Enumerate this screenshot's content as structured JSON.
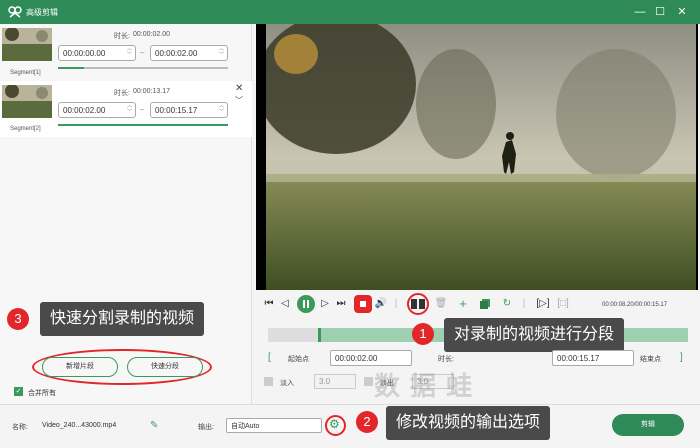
{
  "window": {
    "title": "高级剪辑"
  },
  "segments": [
    {
      "label": "Segment[1]",
      "duration_label": "时长:",
      "duration": "00:00:02.00",
      "start": "00:00:00.00",
      "end": "00:00:02.00",
      "progress": 0.15
    },
    {
      "label": "Segment[2]",
      "duration_label": "时长:",
      "duration": "00:00:13.17",
      "start": "00:00:02.00",
      "end": "00:00:15.17",
      "progress": 1.0
    }
  ],
  "left_buttons": {
    "new_segment": "新增片段",
    "quick_split": "快速分段"
  },
  "merge_all": {
    "label": "合并所有",
    "checked": true
  },
  "player": {
    "time_readout": "00:00:08.20/00:00:15.17"
  },
  "trim": {
    "start_label": "起始点",
    "start_value": "00:00:02.00",
    "duration_label": "时长:",
    "end_value": "00:00:15.17",
    "end_label": "结束点"
  },
  "fade": {
    "in_label": "淡入",
    "in_value": "3.0",
    "out_label": "淡出",
    "out_value": "3.0"
  },
  "footer": {
    "name_label": "名称:",
    "file_name": "Video_240...43000.mp4",
    "output_label": "输出:",
    "output_value": "自动Auto",
    "edit_button": "剪辑"
  },
  "callouts": [
    {
      "num": "1",
      "text": "对录制的视频进行分段"
    },
    {
      "num": "2",
      "text": "修改视频的输出选项"
    },
    {
      "num": "3",
      "text": "快速分割录制的视频"
    }
  ],
  "watermark": "数据蛙",
  "colors": {
    "brand_green": "#2e8b57",
    "accent_green": "#3a9a5b",
    "annotation_red": "#e2262a",
    "callout_bg": "#4a4a4a"
  },
  "icons": [
    "logo-icon",
    "minimize-icon",
    "maximize-icon",
    "close-icon",
    "play-pause-icon",
    "stop-icon",
    "split-icon",
    "delete-icon",
    "add-icon",
    "copy-icon",
    "reset-icon",
    "gear-icon",
    "edit-pencil-icon"
  ]
}
